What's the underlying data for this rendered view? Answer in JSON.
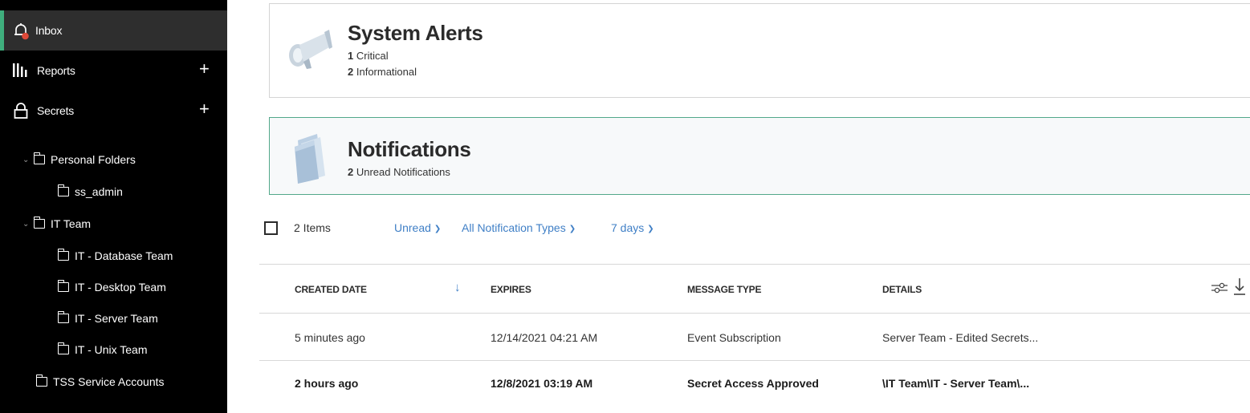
{
  "sidebar": {
    "nav": [
      {
        "label": "Inbox",
        "icon": "bell-icon",
        "active": true
      },
      {
        "label": "Reports",
        "icon": "bar-chart-icon",
        "has_add": true
      },
      {
        "label": "Secrets",
        "icon": "lock-icon",
        "has_add": true
      }
    ],
    "add_symbol": "+",
    "folders": [
      {
        "label": "Personal Folders",
        "expanded": true
      },
      {
        "label": "ss_admin"
      },
      {
        "label": "IT Team",
        "expanded": true
      },
      {
        "label": "IT - Database Team"
      },
      {
        "label": "IT - Desktop Team"
      },
      {
        "label": "IT - Server Team"
      },
      {
        "label": "IT - Unix Team"
      },
      {
        "label": "TSS Service Accounts"
      }
    ],
    "accent_color": "#3fae7d",
    "badge_color": "#e04a3a"
  },
  "alerts": {
    "title": "System Alerts",
    "icon": "megaphone-icon",
    "critical_count": "1",
    "critical_label": "Critical",
    "info_count": "2",
    "info_label": "Informational"
  },
  "notifications": {
    "title": "Notifications",
    "icon": "folder-icon",
    "unread_count": "2",
    "unread_label": "Unread Notifications"
  },
  "filters": {
    "item_count": "2 Items",
    "status": "Unread",
    "type": "All Notification Types",
    "range": "7 days",
    "link_color": "#3f7fc6"
  },
  "table": {
    "columns": [
      "CREATED DATE",
      "EXPIRES",
      "MESSAGE TYPE",
      "DETAILS"
    ],
    "sort_icon": "arrow-down-icon",
    "rows": [
      {
        "created": "5 minutes ago",
        "expires": "12/14/2021 04:21 AM",
        "type": "Event Subscription",
        "details": "Server Team - Edited Secrets...",
        "unread": false
      },
      {
        "created": "2 hours ago",
        "expires": "12/8/2021 03:19 AM",
        "type": "Secret Access Approved",
        "details": "\\IT Team\\IT - Server Team\\...",
        "unread": true
      }
    ]
  }
}
